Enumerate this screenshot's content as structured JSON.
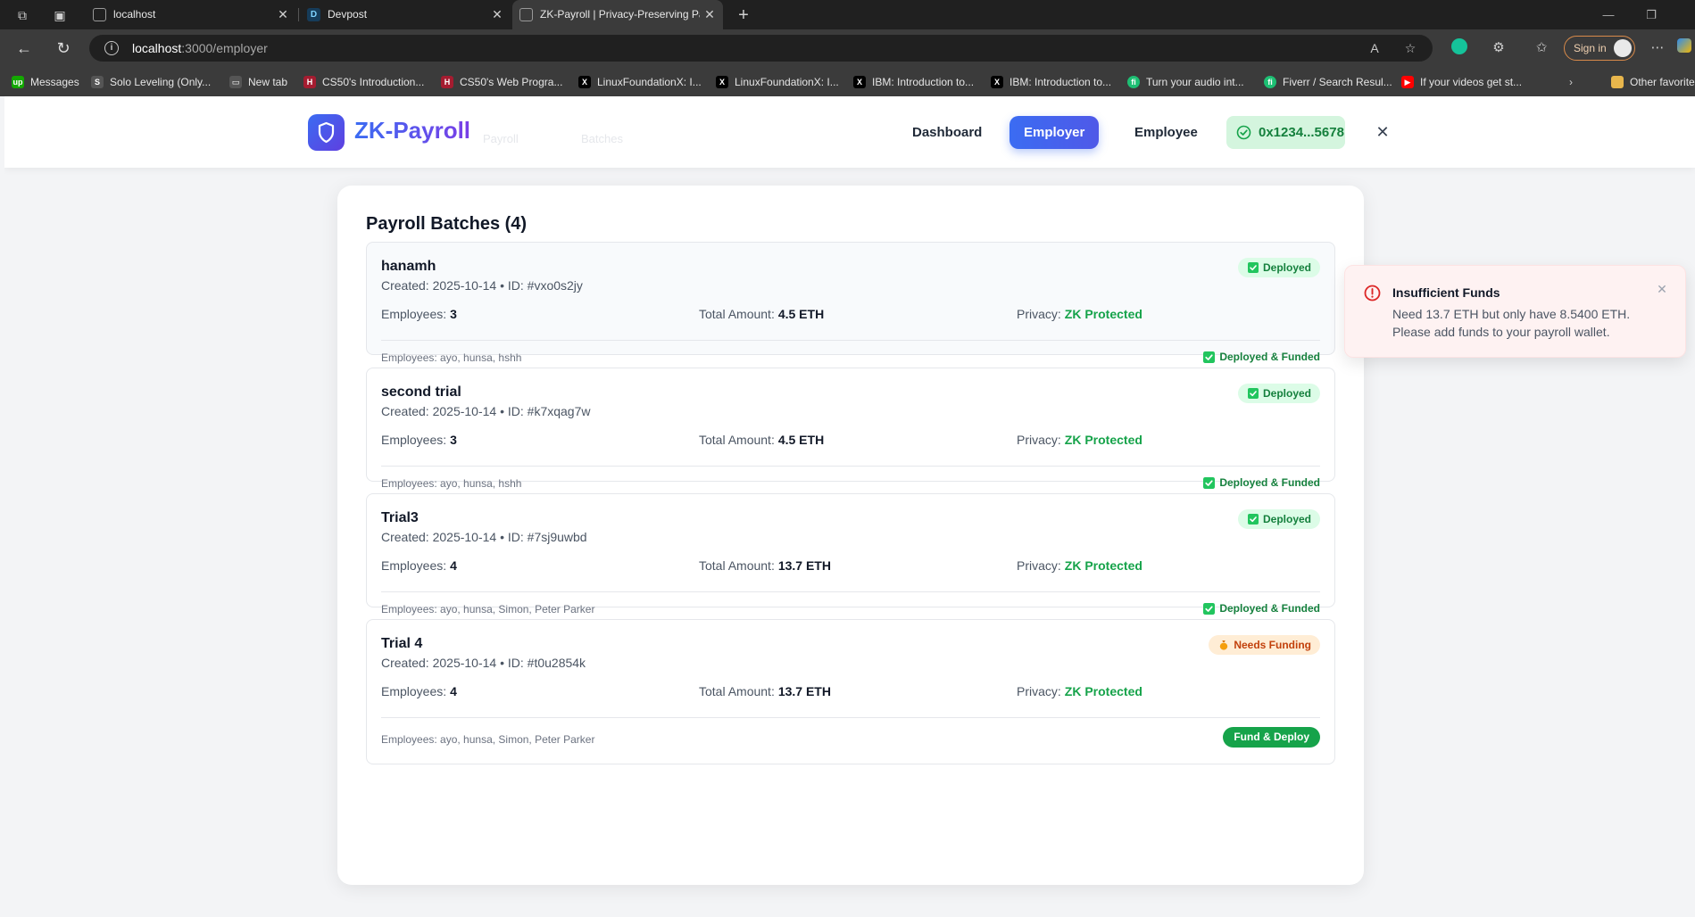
{
  "browser": {
    "tabs": [
      {
        "title": "localhost",
        "favicon": "page-icon"
      },
      {
        "title": "Devpost",
        "favicon": "devpost-icon"
      },
      {
        "title": "ZK-Payroll | Privacy-Preserving Pa",
        "favicon": "page-icon"
      }
    ],
    "new_tab_symbol": "+",
    "url_host": "localhost",
    "url_path": ":3000/employer",
    "sign_in_label": "Sign in",
    "bookmarks": [
      {
        "label": "Messages",
        "favicon_color": "#14a800",
        "glyph": "up"
      },
      {
        "label": "Solo Leveling (Only...",
        "favicon_color": "#555555",
        "glyph": "S"
      },
      {
        "label": "New tab",
        "favicon_color": "#555555",
        "glyph": "▭"
      },
      {
        "label": "CS50's Introduction...",
        "favicon_color": "#a51c30",
        "glyph": "H"
      },
      {
        "label": "CS50's Web Progra...",
        "favicon_color": "#a51c30",
        "glyph": "H"
      },
      {
        "label": "LinuxFoundationX: I...",
        "favicon_color": "#000000",
        "glyph": "X"
      },
      {
        "label": "LinuxFoundationX: I...",
        "favicon_color": "#000000",
        "glyph": "X"
      },
      {
        "label": "IBM: Introduction to...",
        "favicon_color": "#000000",
        "glyph": "X"
      },
      {
        "label": "IBM: Introduction to...",
        "favicon_color": "#000000",
        "glyph": "X"
      },
      {
        "label": "Turn your audio int...",
        "favicon_color": "#1dbf73",
        "glyph": "fi"
      },
      {
        "label": "Fiverr / Search Resul...",
        "favicon_color": "#1dbf73",
        "glyph": "fi"
      },
      {
        "label": "If your videos get st...",
        "favicon_color": "#ff0000",
        "glyph": "▶"
      }
    ],
    "other_favorites": "Other favorite"
  },
  "header": {
    "logo": "ZK-Payroll",
    "ghost_tabs": [
      "Payroll",
      "Batches"
    ],
    "nav": [
      {
        "label": "Dashboard",
        "active": false
      },
      {
        "label": "Employer",
        "active": true
      },
      {
        "label": "Employee",
        "active": false
      }
    ],
    "wallet": "0x1234...5678"
  },
  "main": {
    "title": "Payroll Batches (4)",
    "labels": {
      "employees": "Employees:",
      "total": "Total Amount:",
      "privacy": "Privacy:"
    },
    "batches": [
      {
        "name": "hanamh",
        "meta": "Created: 2025-10-14 • ID: #vxo0s2jy",
        "employees": "3",
        "total": "4.5 ETH",
        "privacy": "ZK Protected",
        "employee_list": "Employees: ayo, hunsa, hshh",
        "status": "Deployed",
        "footer": "Deployed & Funded"
      },
      {
        "name": "second trial",
        "meta": "Created: 2025-10-14 • ID: #k7xqag7w",
        "employees": "3",
        "total": "4.5 ETH",
        "privacy": "ZK Protected",
        "employee_list": "Employees: ayo, hunsa, hshh",
        "status": "Deployed",
        "footer": "Deployed & Funded"
      },
      {
        "name": "Trial3",
        "meta": "Created: 2025-10-14 • ID: #7sj9uwbd",
        "employees": "4",
        "total": "13.7 ETH",
        "privacy": "ZK Protected",
        "employee_list": "Employees: ayo, hunsa, Simon, Peter Parker",
        "status": "Deployed",
        "footer": "Deployed & Funded"
      },
      {
        "name": "Trial 4",
        "meta": "Created: 2025-10-14 • ID: #t0u2854k",
        "employees": "4",
        "total": "13.7 ETH",
        "privacy": "ZK Protected",
        "employee_list": "Employees: ayo, hunsa, Simon, Peter Parker",
        "status": "Needs Funding",
        "footer_button": "Fund & Deploy"
      }
    ]
  },
  "toast": {
    "title": "Insufficient Funds",
    "message": "Need 13.7 ETH but only have 8.5400 ETH. Please add funds to your payroll wallet."
  },
  "colors": {
    "brand_blue": "#3b6cf2",
    "success_green": "#16a34a",
    "warning_orange": "#c2410c",
    "error_red": "#dc2626"
  }
}
